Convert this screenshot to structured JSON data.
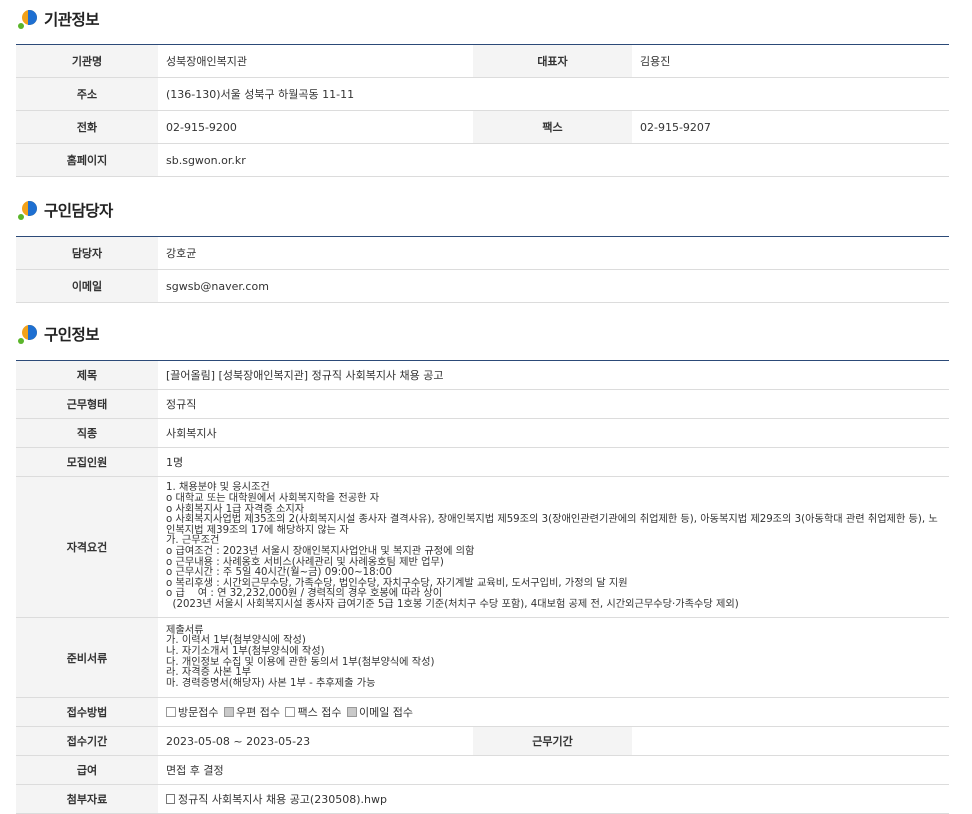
{
  "org": {
    "title": "기관정보",
    "name_label": "기관명",
    "name": "성북장애인복지관",
    "rep_label": "대표자",
    "rep": "김용진",
    "addr_label": "주소",
    "addr": "(136-130)서울 성북구 하월곡동 11-11",
    "phone_label": "전화",
    "phone": "02-915-9200",
    "fax_label": "팩스",
    "fax": "02-915-9207",
    "home_label": "홈페이지",
    "home": "sb.sgwon.or.kr"
  },
  "contact": {
    "title": "구인담당자",
    "person_label": "담당자",
    "person": "강호균",
    "email_label": "이메일",
    "email": "sgwsb@naver.com"
  },
  "job": {
    "title": "구인정보",
    "subject_label": "제목",
    "subject": "[끌어올림] [성북장애인복지관] 정규직 사회복지사 채용 공고",
    "type_label": "근무형태",
    "type": "정규직",
    "role_label": "직종",
    "role": "사회복지사",
    "count_label": "모집인원",
    "count": "1명",
    "req_label": "자격요건",
    "req": "1. 채용분야 및 응시조건\no 대학교 또는 대학원에서 사회복지학을 전공한 자\no 사회복지사 1급 자격증 소지자\no 사회복지사업법 제35조의 2(사회복지시설 종사자 결격사유), 장애인복지법 제59조의 3(장애인관련기관에의 취업제한 등), 아동복지법 제29조의 3(아동학대 관련 취업제한 등), 노인복지법 제39조의 17에 해당하지 않는 자\n가. 근무조건\no 급여조건 : 2023년 서울시 장애인복지사업안내 및 복지관 규정에 의함\no 근무내용 : 사례옹호 서비스(사례관리 및 사례옹호팀 제반 업무)\no 근무시간 : 주 5일 40시간(월~금) 09:00~18:00\no 복리후생 : 시간외근무수당, 가족수당, 법인수당, 자치구수당, 자기계발 교육비, 도서구입비, 가정의 달 지원\no 급    여 : 연 32,232,000원 / 경력직의 경우 호봉에 따라 상이\n  (2023년 서울시 사회복지시설 종사자 급여기준 5급 1호봉 기준(처치구 수당 포함), 4대보험 공제 전, 시간외근무수당·가족수당 제외)",
    "docs_label": "준비서류",
    "docs": "제출서류\n가. 이력서 1부(첨부양식에 작성)\n나. 자기소개서 1부(첨부양식에 작성)\n다. 개인정보 수집 및 이용에 관한 동의서 1부(첨부양식에 작성)\n라. 자격증 사본 1부\n마. 경력증명서(해당자) 사본 1부 - 추후제출 가능",
    "method_label": "접수방법",
    "methods": [
      "방문접수",
      "우편 접수",
      "팩스 접수",
      "이메일 접수"
    ],
    "period_label": "접수기간",
    "period": "2023-05-08 ~ 2023-05-23",
    "workperiod_label": "근무기간",
    "workperiod": "",
    "pay_label": "급여",
    "pay": "면접 후 결정",
    "attach_label": "첨부자료",
    "attach": "정규직 사회복지사 채용 공고(230508).hwp"
  }
}
